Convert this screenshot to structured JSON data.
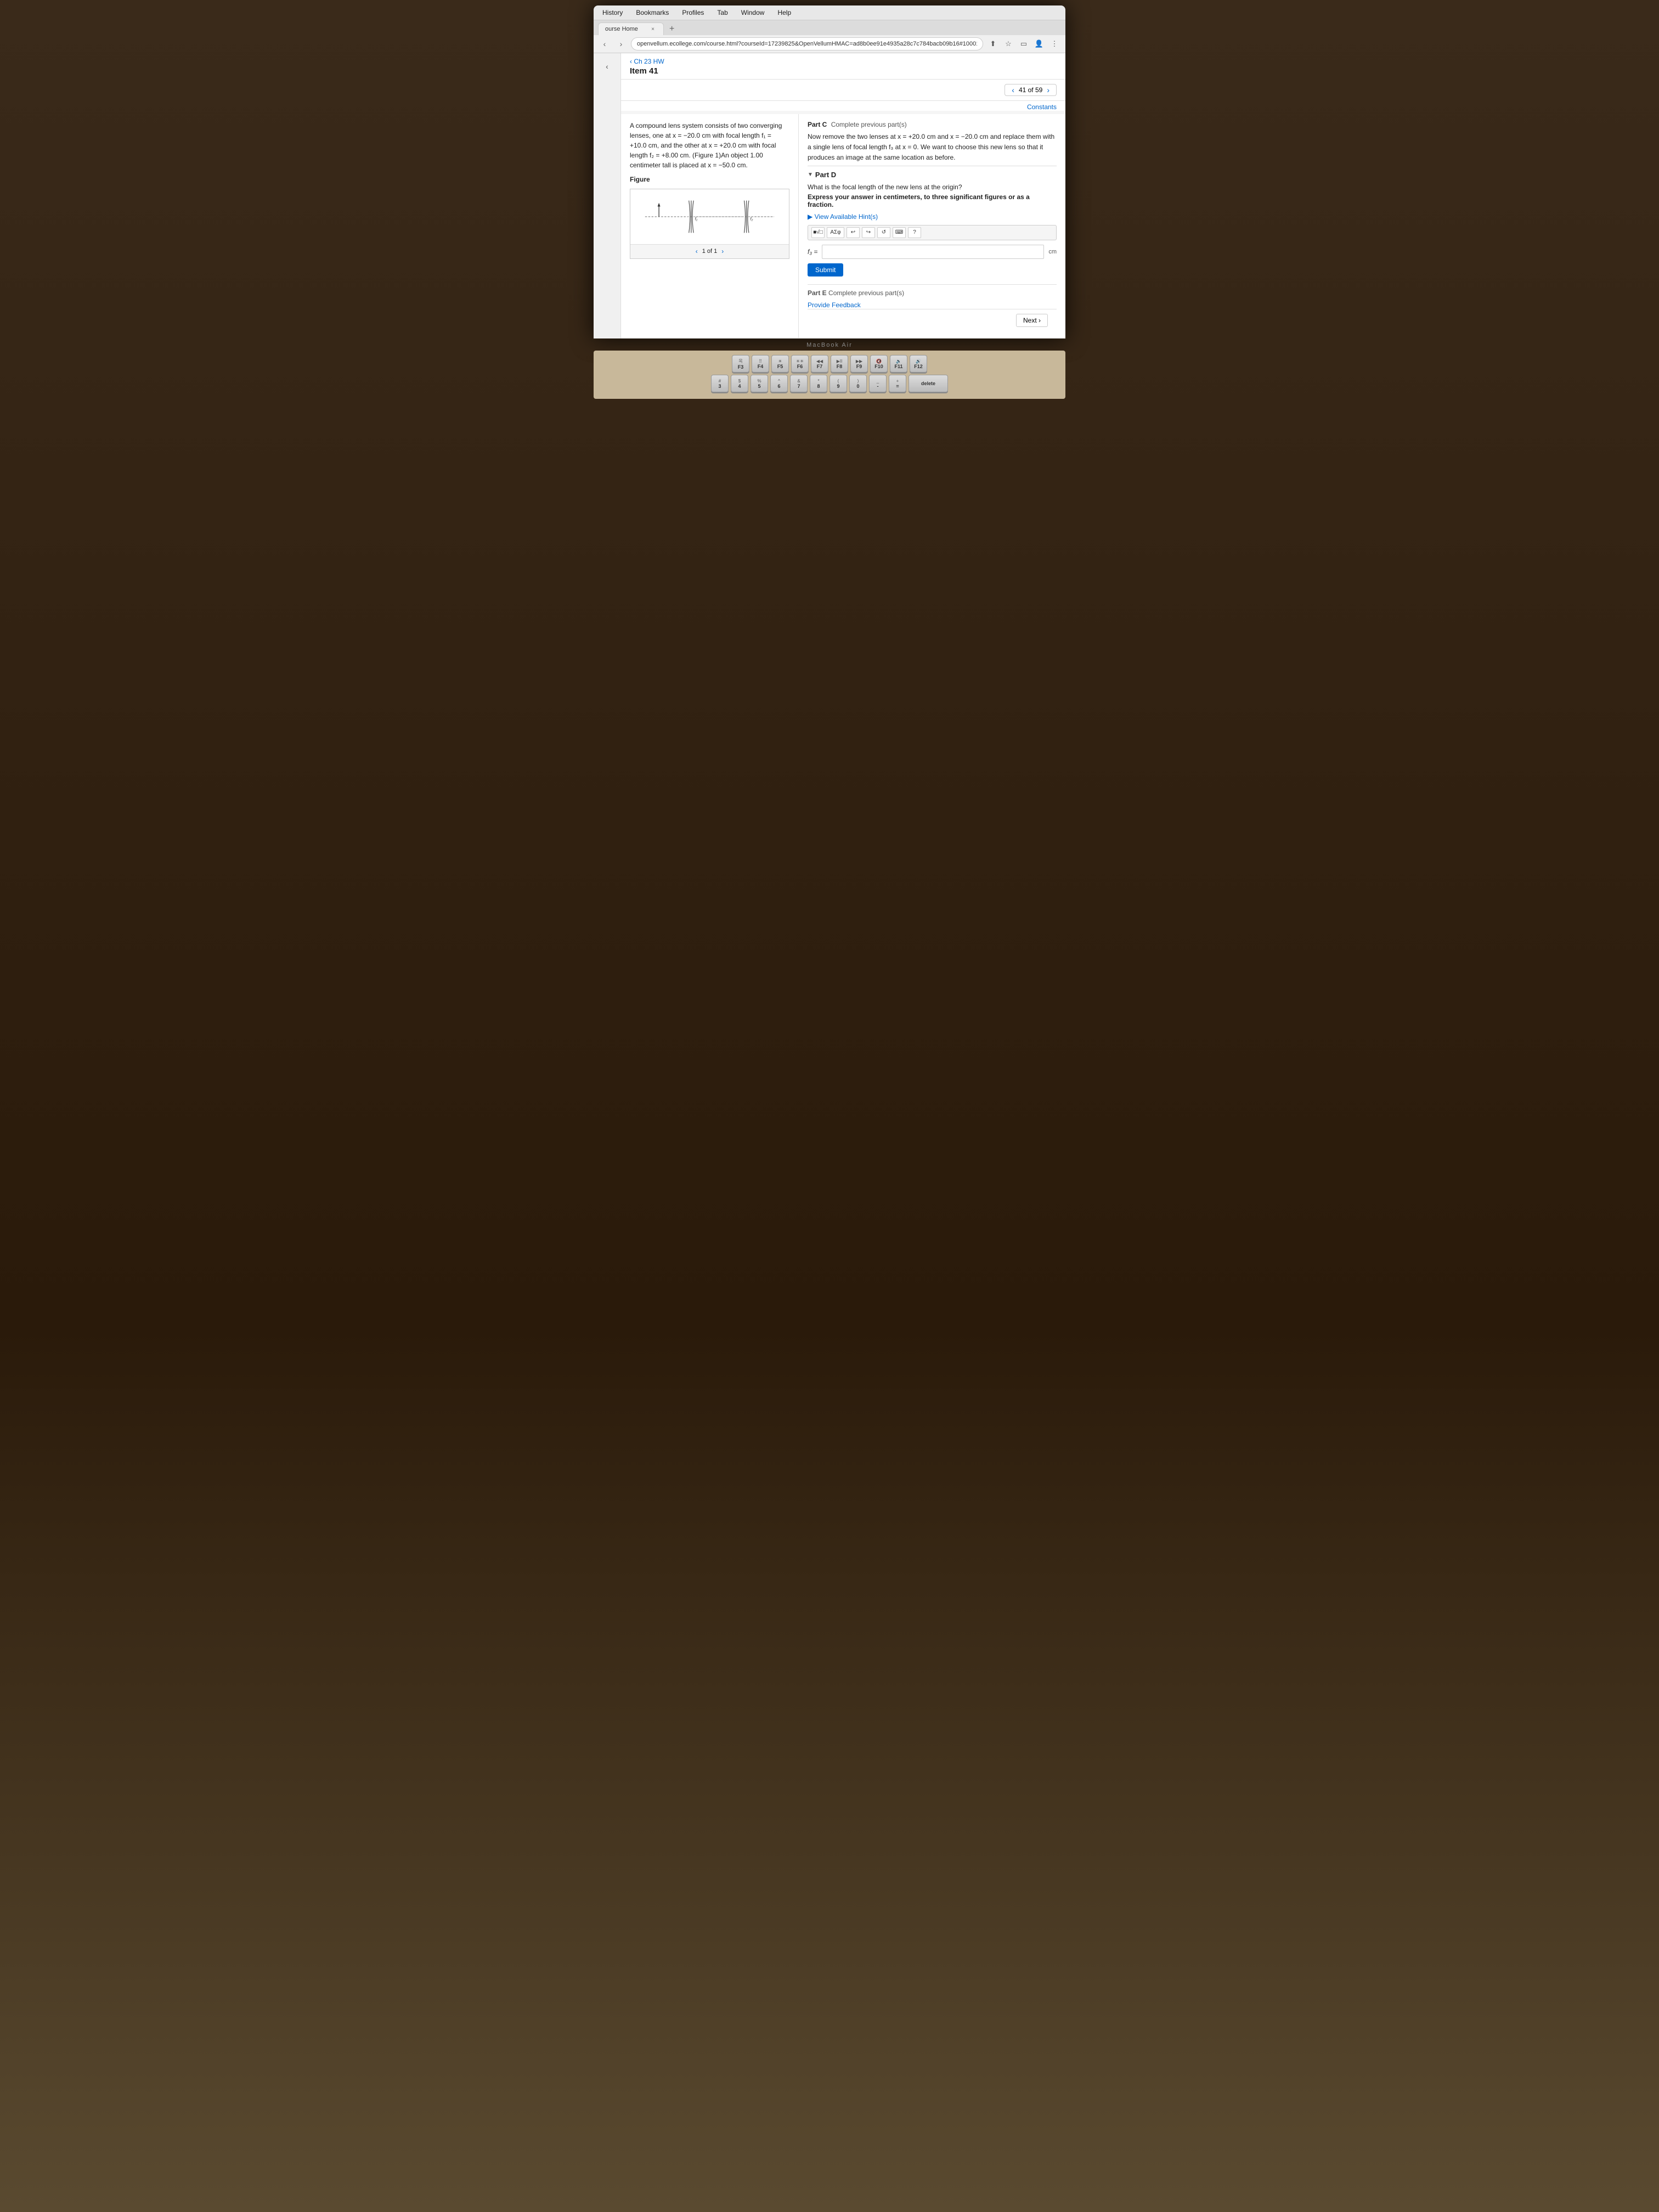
{
  "menu": {
    "items": [
      "History",
      "Bookmarks",
      "Profiles",
      "Tab",
      "Window",
      "Help"
    ]
  },
  "tab": {
    "label": "ourse Home",
    "close": "×",
    "new_tab": "+"
  },
  "url_bar": {
    "value": "openvellum.ecollege.com/course.html?courseId=17239825&OpenVellumHMAC=ad8b0ee91e4935a28c7c784bacb09b16#10001"
  },
  "header": {
    "breadcrumb": "‹ Ch 23 HW",
    "item_title": "Item 41",
    "pagination": "41 of 59",
    "constants_link": "Constants"
  },
  "problem": {
    "description": "A compound lens system consists of two converging lenses, one at x = −20.0 cm with focal length f₁ = +10.0 cm, and the other at x = +20.0 cm with focal length f₂ = +8.00 cm. (Figure 1)An object 1.00 centimeter tall is placed at x = −50.0 cm.",
    "part_c_label": "Part C",
    "part_c_complete": "Complete previous part(s)",
    "part_c_text": "Now remove the two lenses at x = +20.0 cm and x = −20.0 cm and replace them with a single lens of focal length f₃ at x = 0. We want to choose this new lens so that it produces an image at the same location as before.",
    "part_d_label": "Part D",
    "part_d_question": "What is the focal length of the new lens at the origin?",
    "part_d_instruction": "Express your answer in centimeters, to three significant figures or as a fraction.",
    "hint_link": "▶ View Available Hint(s)",
    "input_label": "f₃ =",
    "unit": "cm",
    "submit_label": "Submit",
    "part_e_label": "Part E",
    "part_e_complete": "Complete previous part(s)",
    "feedback_link": "Provide Feedback",
    "next_label": "Next ›"
  },
  "figure": {
    "nav_current": "1 of 1"
  },
  "toolbar_buttons": [
    {
      "label": "■√□",
      "name": "matrix-btn"
    },
    {
      "label": "ΑΣφ",
      "name": "greek-btn"
    },
    {
      "label": "↩",
      "name": "undo-btn"
    },
    {
      "label": "↪",
      "name": "redo-btn"
    },
    {
      "label": "↺",
      "name": "reset-btn"
    },
    {
      "label": "▤",
      "name": "keyboard-btn"
    },
    {
      "label": "?",
      "name": "help-btn"
    }
  ],
  "keyboard": {
    "rows": [
      [
        "F3",
        "F4",
        "F5",
        "F6",
        "F7",
        "F8",
        "F9",
        "F10",
        "F11",
        "F12"
      ],
      [
        "#3",
        "$4",
        "%5",
        "^6",
        "&7",
        "*8",
        "(9",
        ")0",
        "-",
        "+",
        "delete"
      ]
    ]
  }
}
